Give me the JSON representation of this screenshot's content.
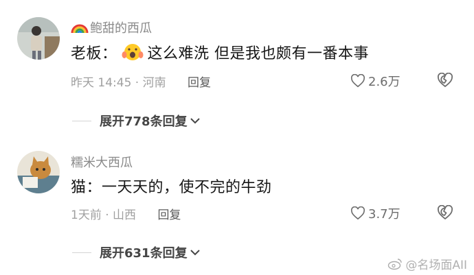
{
  "comments": [
    {
      "username": "鲍甜的西瓜",
      "text_before": "老板：",
      "text_after": "这么难洗 但是我也颇有一番本事",
      "emoji": "shocked-face-emoji",
      "time": "昨天 14:45 · 河南",
      "reply_label": "回复",
      "likes": "2.6万"
    },
    {
      "username": "糯米大西瓜",
      "text_before": "猫：一天天的，使不完的牛劲",
      "time": "1天前 · 山西",
      "reply_label": "回复",
      "likes": "3.7万"
    }
  ],
  "expand_replies": [
    {
      "label": "展开778条回复"
    },
    {
      "label": "展开631条回复"
    }
  ],
  "watermark": "@名场面AII",
  "icons": {
    "like": "heart-outline-icon",
    "dislike": "broken-heart-icon",
    "expand": "chevron-down-icon",
    "rainbow": "rainbow-icon"
  }
}
